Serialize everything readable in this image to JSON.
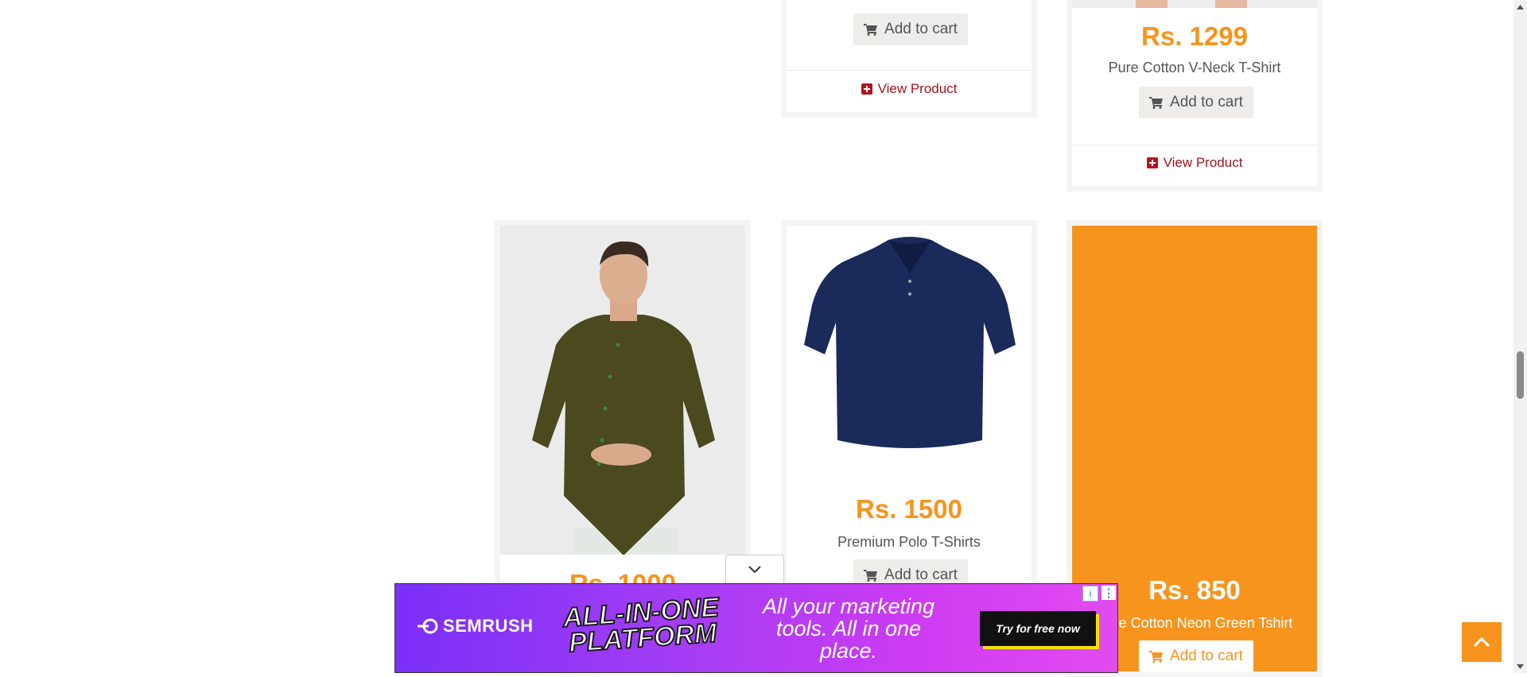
{
  "products": {
    "top_mid": {
      "add_to_cart": "Add to cart",
      "view_product": "View Product"
    },
    "top_right": {
      "price": "Rs. 1299",
      "name": "Pure Cotton V-Neck T-Shirt",
      "add_to_cart": "Add to cart",
      "view_product": "View Product"
    },
    "row2_left": {
      "image_alt": "Olive green asymmetric button shirt on model",
      "price_partial": "Rs. 1000"
    },
    "row2_mid": {
      "image_alt": "Navy blue polo t-shirt",
      "price": "Rs. 1500",
      "name": "Premium Polo T-Shirts",
      "add_to_cart": "Add to cart"
    },
    "row2_right": {
      "price": "Rs. 850",
      "name": "Pure Cotton Neon Green Tshirt",
      "add_to_cart": "Add to cart"
    }
  },
  "ad": {
    "brand": "SEMRUSH",
    "headline": "ALL-IN-ONE PLATFORM",
    "copy": "All your marketing tools. All in one place.",
    "cta": "Try for free now",
    "info_icon": "info-icon",
    "more_icon": "more-vertical-icon"
  },
  "colors": {
    "accent": "#f7941d",
    "link": "#a0141c",
    "ad_purple": "#7b2ff7",
    "ad_pink": "#e14cf0"
  }
}
